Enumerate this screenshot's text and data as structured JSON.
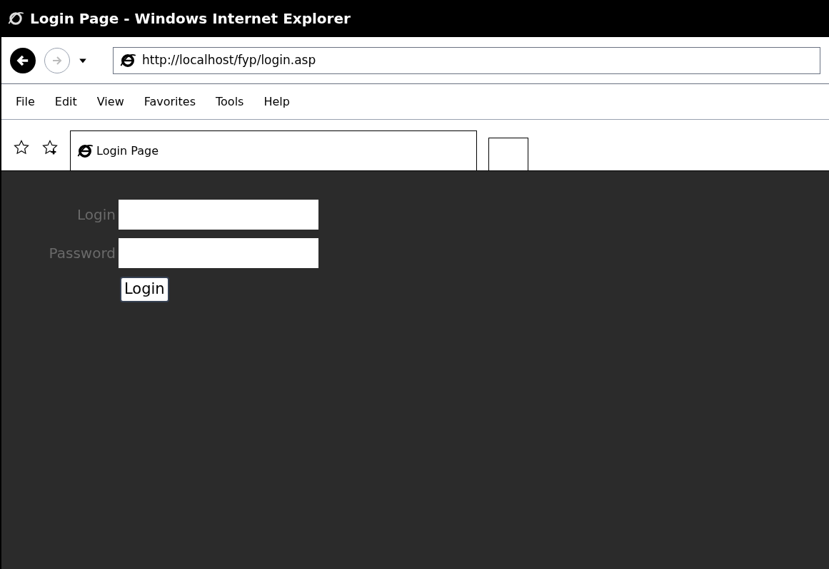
{
  "window": {
    "title": "Login Page - Windows Internet Explorer"
  },
  "address_bar": {
    "url": "http://localhost/fyp/login.asp"
  },
  "menu": [
    "File",
    "Edit",
    "View",
    "Favorites",
    "Tools",
    "Help"
  ],
  "tabs": [
    {
      "label": "Login Page",
      "selected": true
    }
  ],
  "form": {
    "fields": [
      {
        "label": "Login"
      },
      {
        "label": "Password"
      }
    ],
    "button": "Login"
  }
}
